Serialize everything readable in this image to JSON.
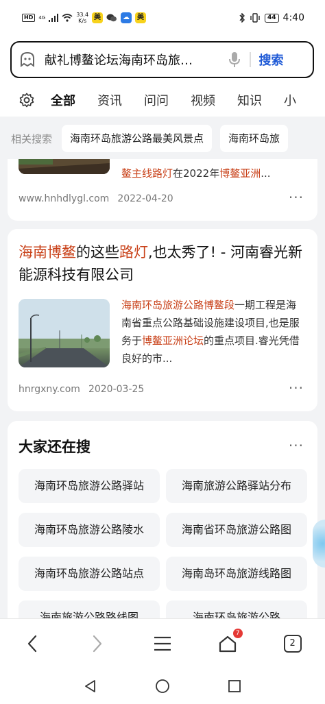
{
  "status_bar": {
    "hd": "HD",
    "network": "4G",
    "speed": "33.4",
    "speed_unit": "K/s",
    "app_badge_1": "美",
    "app_badge_2": "美",
    "battery": "44",
    "time": "4:40"
  },
  "search": {
    "query": "献礼博鳌论坛海南环岛旅…",
    "button_label": "搜索"
  },
  "tabs": [
    "全部",
    "资讯",
    "问问",
    "视频",
    "知识",
    "小"
  ],
  "related": {
    "label": "相关搜索",
    "chips": [
      "海南环岛旅游公路最美风景点",
      "海南环岛旅"
    ]
  },
  "results": [
    {
      "snippet_hl_1": "鳌主线路灯",
      "snippet_text_1": "在2022年",
      "snippet_hl_2": "博鳌亚洲",
      "snippet_text_2": "...",
      "source": "www.hnhdlygl.com",
      "date": "2022-04-20"
    },
    {
      "title_hl_1": "海南博鳌",
      "title_text_1": "的这些",
      "title_hl_2": "路灯",
      "title_text_2": ",也太秀了! - 河南睿光新能源科技有限公司",
      "snippet_hl_1": "海南环岛旅游公路博鳌段",
      "snippet_text_1": "一期工程是海南省重点公路基础设施建设项目,也是服务于",
      "snippet_hl_2": "博鳌亚洲论坛",
      "snippet_text_2": "的重点项目.睿光凭借良好的市...",
      "source": "hnrgxny.com",
      "date": "2020-03-25"
    }
  ],
  "people_also_search": {
    "title": "大家还在搜",
    "items": [
      "海南环岛旅游公路驿站",
      "海南旅游公路驿站分布",
      "海南环岛旅游公路陵水",
      "海南省环岛旅游公路图",
      "海南环岛旅游公路站点",
      "海南岛环岛旅游线路图",
      "海南旅游公路路线图",
      "海南环岛旅游公路"
    ]
  },
  "bottom_nav": {
    "home_badge": "7",
    "tab_count": "2"
  },
  "colors": {
    "accent": "#1f5ad6",
    "highlight": "#c9421a",
    "background": "#f2f3f5"
  }
}
